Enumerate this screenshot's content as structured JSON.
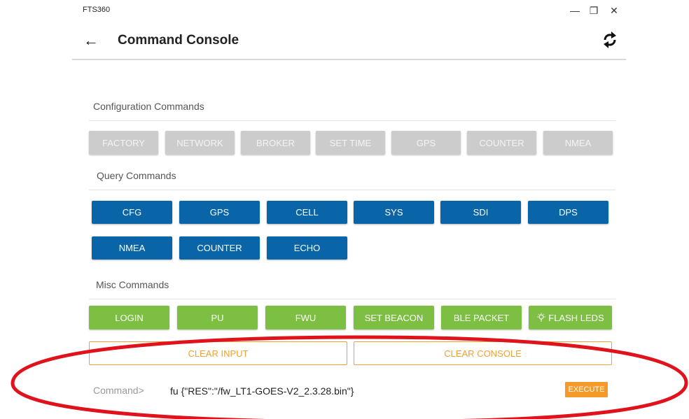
{
  "window": {
    "title": "FTS360",
    "minimize": "—",
    "restore": "❐",
    "close": "✕"
  },
  "header": {
    "back_icon": "←",
    "title": "Command Console"
  },
  "sections": {
    "configuration": {
      "title": "Configuration Commands",
      "buttons": [
        "FACTORY",
        "NETWORK",
        "BROKER",
        "SET TIME",
        "GPS",
        "COUNTER",
        "NMEA"
      ]
    },
    "query": {
      "title": "Query Commands",
      "buttons": [
        "CFG",
        "GPS",
        "CELL",
        "SYS",
        "SDI",
        "DPS",
        "NMEA",
        "COUNTER",
        "ECHO"
      ]
    },
    "misc": {
      "title": "Misc Commands",
      "buttons": [
        "LOGIN",
        "PU",
        "FWU",
        "SET BEACON",
        "BLE PACKET",
        "FLASH LEDS"
      ]
    }
  },
  "actions": {
    "clear_input": "CLEAR INPUT",
    "clear_console": "CLEAR CONSOLE"
  },
  "command": {
    "label": "Command>",
    "value": "fu {\"RES\":\"/fw_LT1-GOES-V2_2.3.28.bin\"}",
    "execute": "EXECUTE"
  },
  "colors": {
    "config_button": "#cccccc",
    "query_button": "#0a64a8",
    "misc_button": "#7cbf42",
    "accent_orange": "#f39a2a",
    "annotation_ellipse": "#e0121b"
  }
}
